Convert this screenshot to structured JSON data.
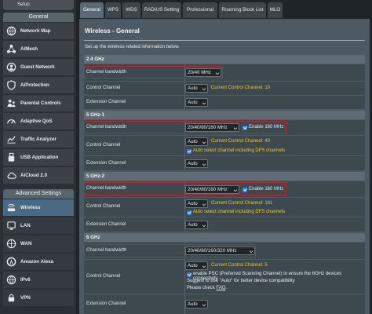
{
  "sidebar": {
    "setup_label": "Setup",
    "general_header": "General",
    "general_items": [
      {
        "label": "Network Map",
        "icon": "network-map-icon"
      },
      {
        "label": "AiMesh",
        "icon": "aimesh-icon"
      },
      {
        "label": "Guest Network",
        "icon": "guest-network-icon"
      },
      {
        "label": "AiProtection",
        "icon": "aiprotection-icon"
      },
      {
        "label": "Parental Controls",
        "icon": "parental-controls-icon"
      },
      {
        "label": "Adaptive QoS",
        "icon": "adaptive-qos-icon"
      },
      {
        "label": "Traffic Analyzer",
        "icon": "traffic-analyzer-icon"
      },
      {
        "label": "USB Application",
        "icon": "usb-icon"
      },
      {
        "label": "AiCloud 2.0",
        "icon": "aicloud-icon"
      }
    ],
    "advanced_header": "Advanced Settings",
    "advanced_items": [
      {
        "label": "Wireless",
        "icon": "wireless-icon"
      },
      {
        "label": "LAN",
        "icon": "lan-icon"
      },
      {
        "label": "WAN",
        "icon": "wan-icon"
      },
      {
        "label": "Amazon Alexa",
        "icon": "alexa-icon"
      },
      {
        "label": "IPv6",
        "icon": "ipv6-icon"
      },
      {
        "label": "VPN",
        "icon": "vpn-icon"
      }
    ]
  },
  "tabs": [
    "General",
    "WPS",
    "WDS",
    "RADIUS Setting",
    "Professional",
    "Roaming Block List",
    "MLO"
  ],
  "main": {
    "title": "Wireless - General",
    "description": "Set up the wireless related information below.",
    "bands": [
      {
        "name": "2.4 GHz",
        "bandwidth_label": "Channel bandwidth",
        "bandwidth_value": "20/40 MHz",
        "control_label": "Control Channel",
        "control_value": "Auto",
        "current_channel": "Current Control Channel: 10",
        "extension_label": "Extension Channel",
        "extension_value": "Auto"
      },
      {
        "name": "5 GHz-1",
        "bandwidth_label": "Channel bandwidth",
        "bandwidth_value": "20/40/80/160 MHz",
        "enable_label": "Enable 160 MHz",
        "control_label": "Control Channel",
        "control_value": "Auto",
        "current_channel": "Current Control Channel: 40",
        "dfs_label": "Auto select channel including DFS channels",
        "extension_label": "Extension Channel",
        "extension_value": "Auto"
      },
      {
        "name": "5 GHz-2",
        "bandwidth_label": "Channel bandwidth",
        "bandwidth_value": "20/40/80/160 MHz",
        "enable_label": "Enable 160 MHz",
        "control_label": "Control Channel",
        "control_value": "Auto",
        "current_channel": "Current Control Channel: 161",
        "dfs_label": "Auto select channel including DFS channels",
        "extension_label": "Extension Channel",
        "extension_value": "Auto"
      },
      {
        "name": "6 GHz",
        "bandwidth_label": "Channel bandwidth",
        "bandwidth_value": "20/40/80/160/320 MHz",
        "control_label": "Control Channel",
        "control_value": "Auto",
        "current_channel": "Current Control Channel: 5",
        "psc_label": "enable PSC (Preferred Scanning Channel) to ensure the 6GHz devices connectivity",
        "suggest_text": "Suggest to use \"Auto\" for better device compatibility",
        "check_prefix": "Please check",
        "faq_label": "FAQ",
        "faq_suffix": ".",
        "extension_label": "Extension Channel",
        "extension_value": "Auto"
      }
    ]
  },
  "colors": {
    "highlight": "#c8232b",
    "accent_yellow": "#e7c93a",
    "active_nav": "#4a6a84",
    "checkbox": "#2d7fd6"
  }
}
